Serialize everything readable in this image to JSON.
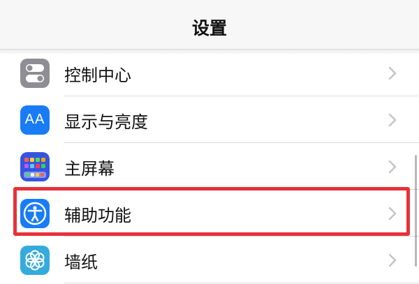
{
  "header": {
    "title": "设置"
  },
  "rows": [
    {
      "label": "控制中心",
      "icon": "control-center-icon"
    },
    {
      "label": "显示与亮度",
      "icon": "display-brightness-icon",
      "icon_text": "AA"
    },
    {
      "label": "主屏幕",
      "icon": "home-screen-icon"
    },
    {
      "label": "辅助功能",
      "icon": "accessibility-icon",
      "highlighted": true
    },
    {
      "label": "墙纸",
      "icon": "wallpaper-icon"
    }
  ],
  "colors": {
    "highlight": "#e8313a",
    "control_center_bg": "#8e8e93",
    "display_bg": "#1a7cf5",
    "home_screen_bg": "#3555e0",
    "accessibility_bg": "#1a7cf5",
    "wallpaper_bg": "#35aadc",
    "chevron": "#c4c4c7"
  }
}
